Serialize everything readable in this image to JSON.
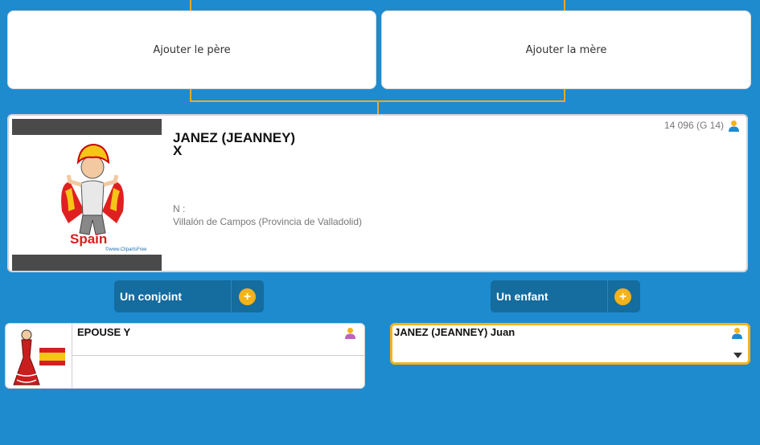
{
  "parents": {
    "father_label": "Ajouter le père",
    "mother_label": "Ajouter la mère"
  },
  "person": {
    "surname": "JANEZ (JEANNEY)",
    "given": "X",
    "sosa": "14 096 (G 14)",
    "birth_label": "N :",
    "birth_place": "Villalón de Campos (Provincia de Valladolid)",
    "photo_caption": "Spain",
    "photo_credit": "©www.ClipartsFree"
  },
  "actions": {
    "spouse_label": "Un conjoint",
    "child_label": "Un enfant"
  },
  "spouse": {
    "name": "EPOUSE Y"
  },
  "child": {
    "name": "JANEZ (JEANNEY) Juan"
  },
  "colors": {
    "background": "#1e8bcf",
    "connector": "#f0a820",
    "button": "#156c9e",
    "plus": "#f5b21a",
    "male_icon": "#1e8bcf",
    "female_icon": "#c060c0"
  },
  "icons": [
    "male-person-icon",
    "female-person-icon",
    "plus-icon",
    "chevron-down-icon"
  ]
}
